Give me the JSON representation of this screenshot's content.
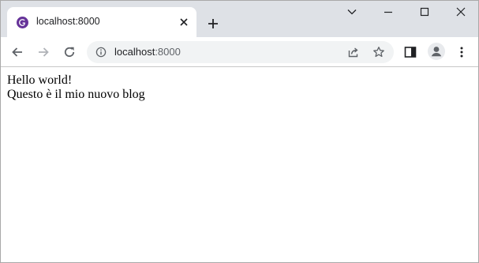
{
  "browser": {
    "tab": {
      "title": "localhost:8000",
      "favicon": "gatsby-icon"
    },
    "address_bar": {
      "host": "localhost",
      "port": ":8000"
    },
    "colors": {
      "tabstrip": "#dee1e6",
      "omnibox": "#f1f3f4",
      "favicon": "#663399",
      "icon": "#5f6368",
      "icon_disabled": "#b0b3b8"
    }
  },
  "page": {
    "lines": [
      "Hello world!",
      "Questo è il mio nuovo blog"
    ]
  }
}
